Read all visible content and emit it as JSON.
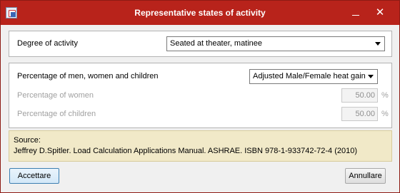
{
  "window": {
    "title": "Representative states of activity",
    "minimize_label": "",
    "close_label": "✕"
  },
  "activity": {
    "label": "Degree of activity",
    "selected": "Seated at theater, matinee"
  },
  "composition": {
    "label": "Percentage of men, women and children",
    "selected": "Adjusted Male/Female heat gain",
    "women_label": "Percentage of women",
    "women_value": "50.00",
    "women_unit": "%",
    "children_label": "Percentage of children",
    "children_value": "50.00",
    "children_unit": "%"
  },
  "source": {
    "heading": "Source:",
    "text": "Jeffrey D.Spitler. Load Calculation Applications Manual. ASHRAE. ISBN 978-1-933742-72-4 (2010)"
  },
  "buttons": {
    "accept": "Accettare",
    "cancel": "Annullare"
  },
  "colors": {
    "titlebar": "#b8231b",
    "source_bg": "#f1e9c8"
  }
}
